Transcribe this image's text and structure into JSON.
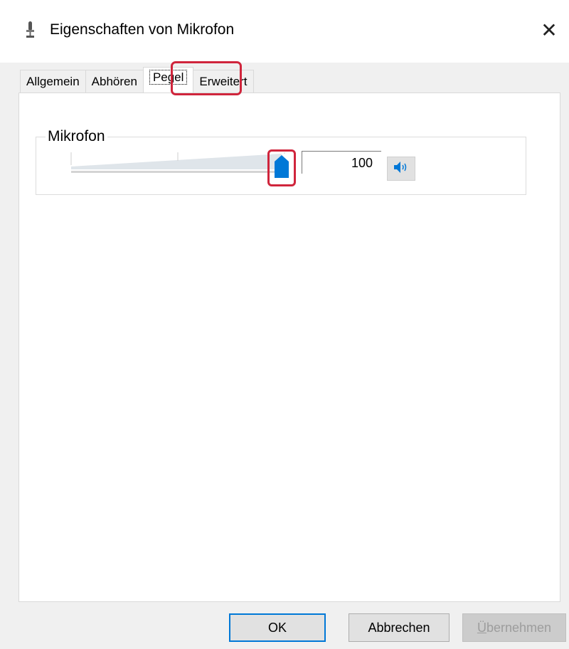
{
  "window": {
    "title": "Eigenschaften von Mikrofon",
    "title_icon": "microphone-icon",
    "close_label": "✕"
  },
  "tabs": [
    {
      "label": "Allgemein",
      "active": false
    },
    {
      "label": "Abhören",
      "active": false
    },
    {
      "label": "Pegel",
      "active": true
    },
    {
      "label": "Erweitert",
      "active": false
    }
  ],
  "level_group": {
    "label": "Mikrofon",
    "slider_value": 100,
    "slider_max": 100,
    "value_text": "100",
    "mute_icon": "speaker-icon"
  },
  "buttons": {
    "ok": "OK",
    "cancel": "Abbrechen",
    "apply_mnemonic": "Ü",
    "apply_rest": "bernehmen"
  },
  "colors": {
    "highlight": "#d0253c",
    "accent": "#0078d7"
  }
}
